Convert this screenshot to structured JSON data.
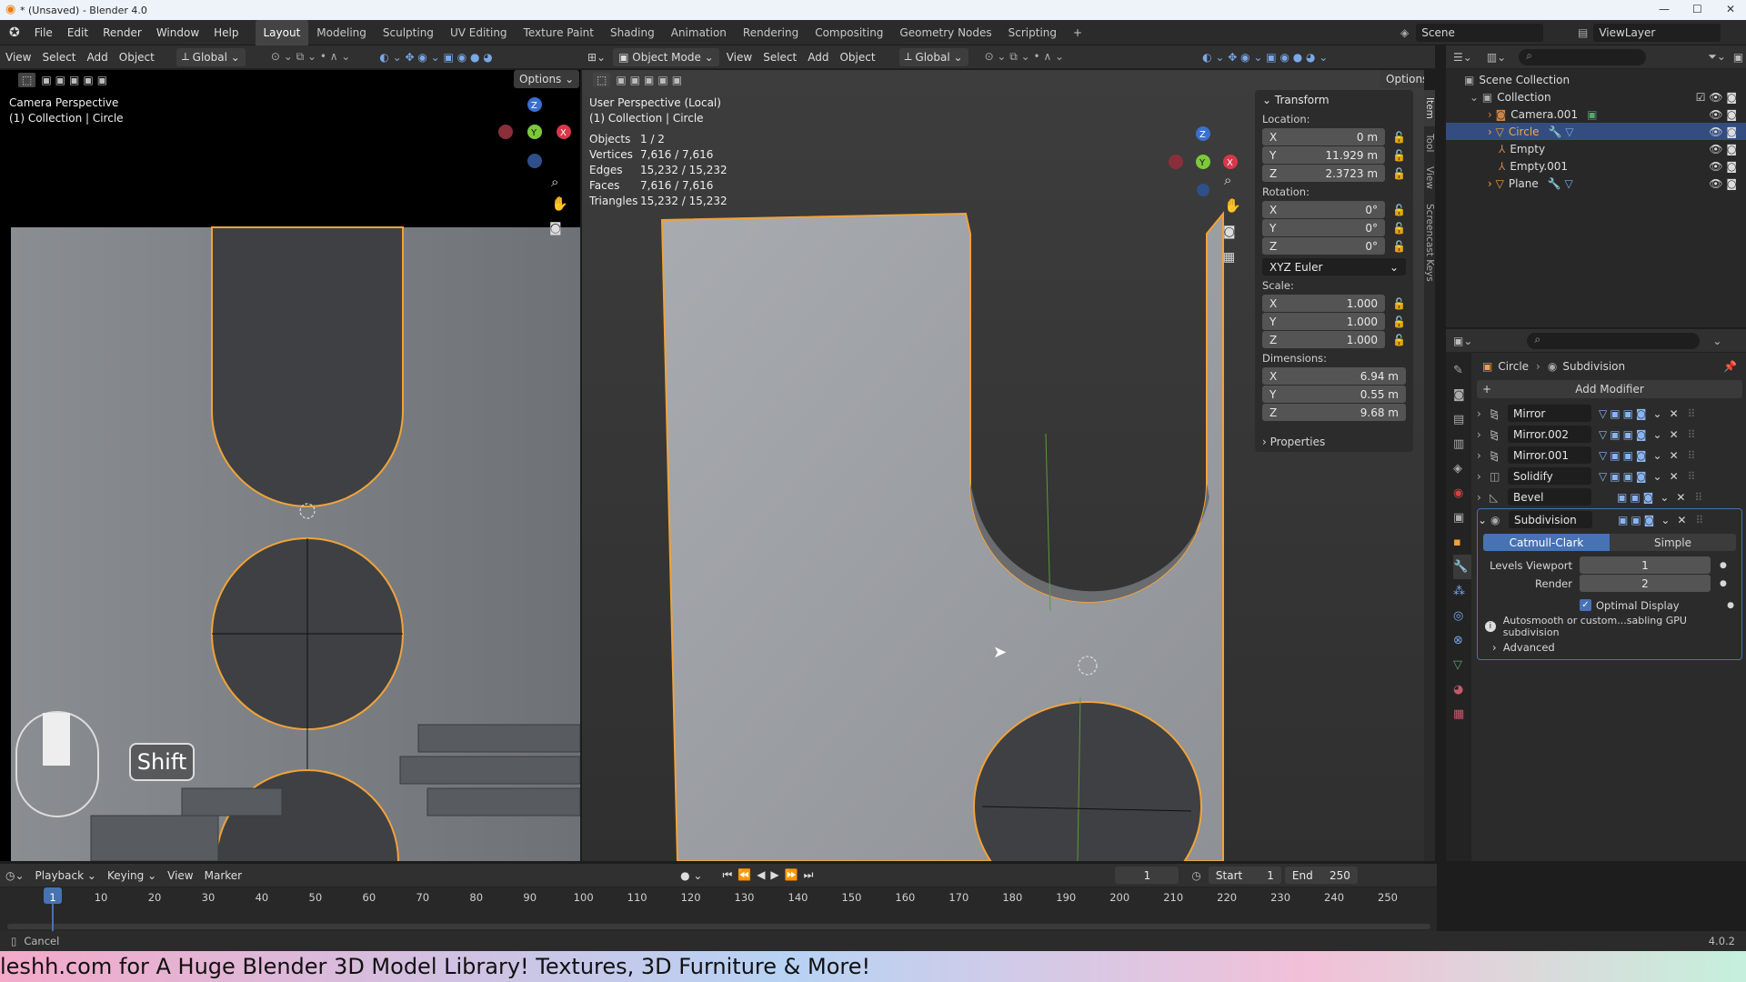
{
  "window": {
    "title": "* (Unsaved) - Blender 4.0"
  },
  "menu": [
    "File",
    "Edit",
    "Render",
    "Window",
    "Help"
  ],
  "workspaces": [
    "Layout",
    "Modeling",
    "Sculpting",
    "UV Editing",
    "Texture Paint",
    "Shading",
    "Animation",
    "Rendering",
    "Compositing",
    "Geometry Nodes",
    "Scripting"
  ],
  "scene": "Scene",
  "view_layer": "ViewLayer",
  "left_viewport": {
    "menu": [
      "View",
      "Select",
      "Add",
      "Object"
    ],
    "orientation": "Global",
    "options": "Options",
    "overlay_title": "Camera Perspective",
    "overlay_sub": "(1) Collection | Circle",
    "key_hint": "Shift"
  },
  "right_viewport": {
    "mode": "Object Mode",
    "menu": [
      "View",
      "Select",
      "Add",
      "Object"
    ],
    "orientation": "Global",
    "options": "Options",
    "overlay_title": "User Perspective (Local)",
    "overlay_sub": "(1) Collection | Circle",
    "stats": [
      {
        "k": "Objects",
        "v": "1 / 2"
      },
      {
        "k": "Vertices",
        "v": "7,616 / 7,616"
      },
      {
        "k": "Edges",
        "v": "15,232 / 15,232"
      },
      {
        "k": "Faces",
        "v": "7,616 / 7,616"
      },
      {
        "k": "Triangles",
        "v": "15,232 / 15,232"
      }
    ]
  },
  "npanel": {
    "header": "Transform",
    "location_label": "Location:",
    "location": [
      {
        "a": "X",
        "v": "0 m"
      },
      {
        "a": "Y",
        "v": "11.929 m"
      },
      {
        "a": "Z",
        "v": "2.3723 m"
      }
    ],
    "rotation_label": "Rotation:",
    "rotation": [
      {
        "a": "X",
        "v": "0°"
      },
      {
        "a": "Y",
        "v": "0°"
      },
      {
        "a": "Z",
        "v": "0°"
      }
    ],
    "rotation_mode": "XYZ Euler",
    "scale_label": "Scale:",
    "scale": [
      {
        "a": "X",
        "v": "1.000"
      },
      {
        "a": "Y",
        "v": "1.000"
      },
      {
        "a": "Z",
        "v": "1.000"
      }
    ],
    "dimensions_label": "Dimensions:",
    "dimensions": [
      {
        "a": "X",
        "v": "6.94 m"
      },
      {
        "a": "Y",
        "v": "0.55 m"
      },
      {
        "a": "Z",
        "v": "9.68 m"
      }
    ],
    "properties": "Properties",
    "tabs": [
      "Item",
      "Tool",
      "View",
      "Screencast Keys"
    ]
  },
  "outliner": {
    "root": "Scene Collection",
    "collection": "Collection",
    "items": [
      "Camera.001",
      "Circle",
      "Empty",
      "Empty.001",
      "Plane"
    ]
  },
  "properties": {
    "breadcrumb_obj": "Circle",
    "breadcrumb_mod": "Subdivision",
    "add_modifier": "Add Modifier",
    "modifiers": [
      "Mirror",
      "Mirror.002",
      "Mirror.001",
      "Solidify",
      "Bevel",
      "Subdivision"
    ],
    "subdiv": {
      "tab1": "Catmull-Clark",
      "tab2": "Simple",
      "levels_label": "Levels Viewport",
      "levels": "1",
      "render_label": "Render",
      "render": "2",
      "optimal": "Optimal Display",
      "info": "Autosmooth or custom...sabling GPU subdivision",
      "advanced": "Advanced"
    }
  },
  "timeline": {
    "menu": [
      "Playback",
      "Keying",
      "View",
      "Marker"
    ],
    "frame": "1",
    "start_label": "Start",
    "start": "1",
    "end_label": "End",
    "end": "250",
    "ticks": [
      "1",
      "10",
      "20",
      "30",
      "40",
      "50",
      "60",
      "70",
      "80",
      "90",
      "100",
      "110",
      "120",
      "130",
      "140",
      "150",
      "160",
      "170",
      "180",
      "190",
      "200",
      "210",
      "220",
      "230",
      "240",
      "250"
    ]
  },
  "status": {
    "left": "Cancel",
    "version": "4.0.2"
  },
  "banner": "leshh.com for A Huge Blender 3D Model Library! Textures, 3D Furniture & More!",
  "colors": {
    "accent": "#4772b3",
    "select_orange": "#f0a33a",
    "bg": "#1d1d1d"
  }
}
